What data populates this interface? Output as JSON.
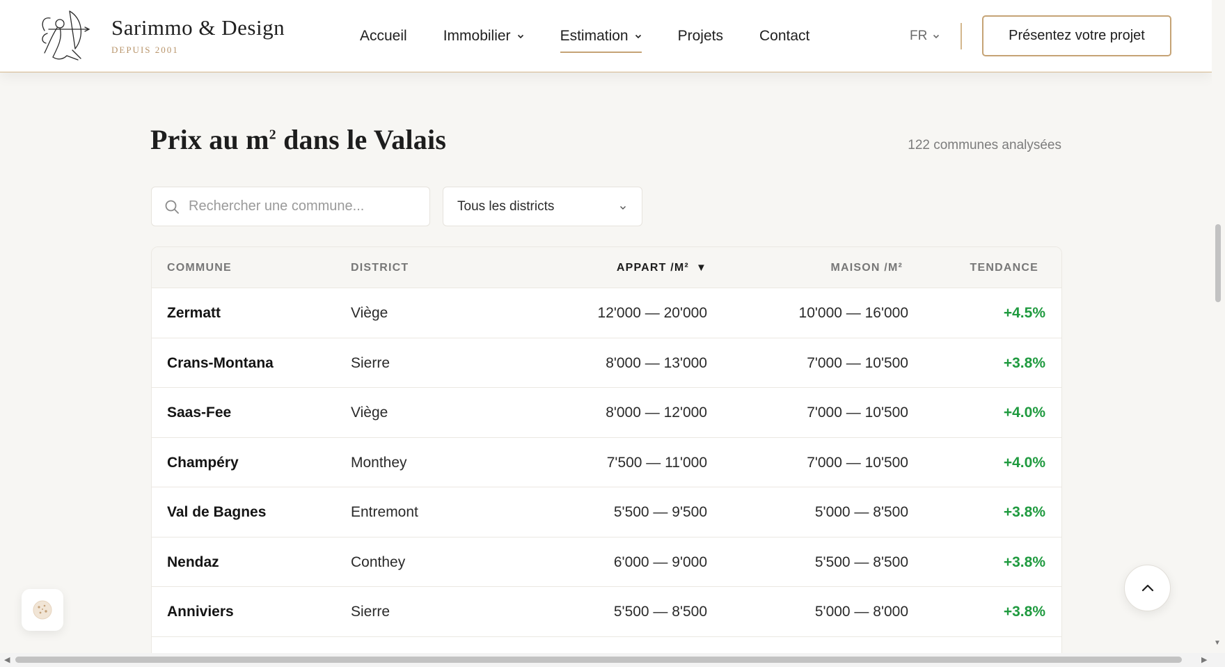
{
  "brand": {
    "name": "Sarimmo & Design",
    "tagline": "DEPUIS 2001"
  },
  "nav": {
    "items": [
      {
        "label": "Accueil",
        "has_dropdown": false
      },
      {
        "label": "Immobilier",
        "has_dropdown": true
      },
      {
        "label": "Estimation",
        "has_dropdown": true,
        "active": true
      },
      {
        "label": "Projets",
        "has_dropdown": false
      },
      {
        "label": "Contact",
        "has_dropdown": false
      }
    ],
    "language": "FR",
    "cta_label": "Présentez votre projet"
  },
  "page": {
    "title_prefix": "Prix au m",
    "title_sup": "2",
    "title_suffix": " dans le Valais",
    "count_text": "122 communes analysées"
  },
  "filters": {
    "search_placeholder": "Rechercher une commune...",
    "search_value": "",
    "district_selected": "Tous les districts"
  },
  "table": {
    "headers": {
      "commune": "COMMUNE",
      "district": "DISTRICT",
      "appart": "APPART /M²",
      "maison": "MAISON /M²",
      "tendance": "TENDANCE"
    },
    "sort_indicator": "▼",
    "rows": [
      {
        "commune": "Zermatt",
        "district": "Viège",
        "appart": "12'000 — 20'000",
        "maison": "10'000 — 16'000",
        "tendance": "+4.5%"
      },
      {
        "commune": "Crans-Montana",
        "district": "Sierre",
        "appart": "8'000 — 13'000",
        "maison": "7'000 — 10'500",
        "tendance": "+3.8%"
      },
      {
        "commune": "Saas-Fee",
        "district": "Viège",
        "appart": "8'000 — 12'000",
        "maison": "7'000 — 10'500",
        "tendance": "+4.0%"
      },
      {
        "commune": "Champéry",
        "district": "Monthey",
        "appart": "7'500 — 11'000",
        "maison": "7'000 — 10'500",
        "tendance": "+4.0%"
      },
      {
        "commune": "Val de Bagnes",
        "district": "Entremont",
        "appart": "5'500 — 9'500",
        "maison": "5'000 — 8'500",
        "tendance": "+3.8%"
      },
      {
        "commune": "Nendaz",
        "district": "Conthey",
        "appart": "6'000 — 9'000",
        "maison": "5'500 — 8'500",
        "tendance": "+3.8%"
      },
      {
        "commune": "Anniviers",
        "district": "Sierre",
        "appart": "5'500 — 8'500",
        "maison": "5'000 — 8'000",
        "tendance": "+3.8%"
      },
      {
        "commune": "",
        "district": "",
        "appart": "",
        "maison": "",
        "tendance": ""
      }
    ]
  },
  "colors": {
    "accent_gold": "#c5a375",
    "trend_green": "#1f9a3f",
    "background": "#f7f6f3"
  },
  "icons": {
    "logo": "archer-cupid-icon",
    "search": "search-icon",
    "dropdown": "chevron-down-icon",
    "sort": "sort-desc-icon",
    "cookie": "cookie-icon",
    "back_to_top": "chevron-up-icon"
  }
}
